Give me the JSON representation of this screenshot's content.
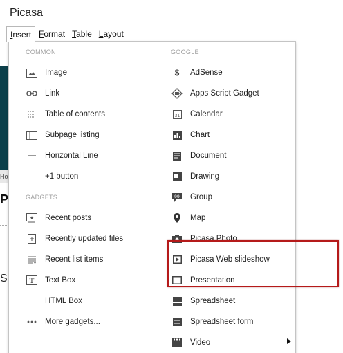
{
  "app": {
    "title": "Picasa"
  },
  "menubar": {
    "tabs": [
      {
        "underline": "I",
        "rest": "nsert"
      },
      {
        "underline": "F",
        "rest": "ormat"
      },
      {
        "underline": "T",
        "rest": "able"
      },
      {
        "underline": "L",
        "rest": "ayout"
      }
    ]
  },
  "background": {
    "ho": "Ho",
    "pi": "Pi",
    "s": "S"
  },
  "dropdown": {
    "common_header": "COMMON",
    "common": [
      {
        "label": "Image",
        "icon": "image-icon"
      },
      {
        "label": "Link",
        "icon": "link-icon"
      },
      {
        "label": "Table of contents",
        "icon": "table-of-contents-icon"
      },
      {
        "label": "Subpage listing",
        "icon": "subpage-listing-icon"
      },
      {
        "label": "Horizontal Line",
        "icon": "horizontal-line-icon"
      },
      {
        "label": "+1 button",
        "icon": ""
      }
    ],
    "gadgets_header": "GADGETS",
    "gadgets": [
      {
        "label": "Recent posts",
        "icon": "recent-posts-icon"
      },
      {
        "label": "Recently updated files",
        "icon": "recently-updated-files-icon"
      },
      {
        "label": "Recent list items",
        "icon": "recent-list-items-icon"
      },
      {
        "label": "Text Box",
        "icon": "text-box-icon"
      },
      {
        "label": "HTML Box",
        "icon": ""
      },
      {
        "label": "More gadgets...",
        "icon": "more-icon"
      }
    ],
    "google_header": "GOOGLE",
    "google": [
      {
        "label": "AdSense",
        "icon": "adsense-icon"
      },
      {
        "label": "Apps Script Gadget",
        "icon": "apps-script-icon"
      },
      {
        "label": "Calendar",
        "icon": "calendar-icon"
      },
      {
        "label": "Chart",
        "icon": "chart-icon"
      },
      {
        "label": "Document",
        "icon": "document-icon"
      },
      {
        "label": "Drawing",
        "icon": "drawing-icon"
      },
      {
        "label": "Group",
        "icon": "group-icon"
      },
      {
        "label": "Map",
        "icon": "map-pin-icon"
      },
      {
        "label": "Picasa Photo",
        "icon": "camera-icon"
      },
      {
        "label": "Picasa Web slideshow",
        "icon": "slideshow-icon"
      },
      {
        "label": "Presentation",
        "icon": "presentation-icon"
      },
      {
        "label": "Spreadsheet",
        "icon": "spreadsheet-icon"
      },
      {
        "label": "Spreadsheet form",
        "icon": "spreadsheet-form-icon"
      },
      {
        "label": "Video",
        "icon": "video-icon"
      }
    ]
  },
  "colors": {
    "highlight_border": "#b51a1a"
  }
}
